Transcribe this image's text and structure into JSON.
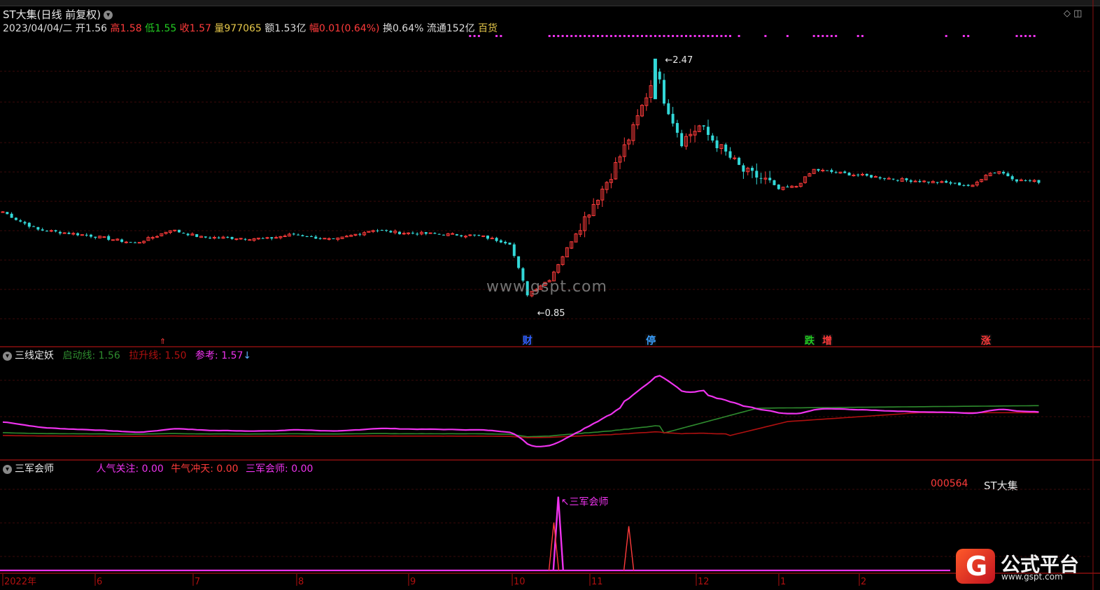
{
  "header": {
    "title": "ST大集(日线 前复权)",
    "info": {
      "date": "2023/04/04/二",
      "open_label": "开",
      "open": "1.56",
      "high_label": "高",
      "high": "1.58",
      "low_label": "低",
      "low": "1.55",
      "close_label": "收",
      "close": "1.57",
      "vol_label": "量",
      "vol": "977065",
      "amt_label": "额",
      "amt": "1.53亿",
      "chg_label": "幅",
      "chg": "0.01(0.64%)",
      "turn_label": "换",
      "turn": "0.64%",
      "float_label": "流通",
      "float": "152亿",
      "sector": "百货"
    }
  },
  "watermark": "www.gspt.com",
  "logo": {
    "title": "公式平台",
    "url": "www.gspt.com"
  },
  "colors": {
    "up": "#ff3b3b",
    "down": "#32d8d8",
    "magenta": "#ee33ee",
    "green": "#2e8b2e",
    "darkred": "#b01010",
    "axis": "#b01010"
  },
  "chart_data": [
    {
      "type": "candlestick",
      "title": "ST大集(日线 前复权)",
      "ylim": [
        0.7,
        2.6
      ],
      "annotations": [
        {
          "label": "2.47",
          "x_index": 148,
          "value": 2.47,
          "kind": "high"
        },
        {
          "label": "0.85",
          "x_index": 119,
          "value": 0.85,
          "kind": "low"
        }
      ],
      "signals": [
        {
          "label": "财",
          "x_index": 119,
          "color": "#3060ff"
        },
        {
          "label": "停",
          "x_index": 147,
          "color": "#3aa0ff"
        },
        {
          "label": "跌",
          "x_index": 183,
          "color": "#22cc22"
        },
        {
          "label": "增",
          "x_index": 187,
          "color": "#ff3b3b"
        },
        {
          "label": "涨",
          "x_index": 223,
          "color": "#ff3b3b"
        }
      ],
      "x_axis": {
        "labels": [
          "2022年",
          "6",
          "7",
          "8",
          "9",
          "10",
          "11",
          "12",
          "1",
          "2"
        ]
      }
    },
    {
      "type": "line",
      "title": "三线定妖",
      "legend": [
        {
          "name": "启动线",
          "value": "1.56",
          "color": "#2e8b2e"
        },
        {
          "name": "拉升线",
          "value": "1.50",
          "color": "#b01010"
        },
        {
          "name": "参考",
          "value": "1.57",
          "color": "#ee33ee"
        }
      ],
      "ylim": [
        0.8,
        2.6
      ]
    },
    {
      "type": "line",
      "title": "三军会师",
      "legend": [
        {
          "name": "人气关注",
          "value": "0.00",
          "color": "#ee33ee"
        },
        {
          "name": "牛气冲天",
          "value": "0.00",
          "color": "#ff3b3b"
        },
        {
          "name": "三军会师",
          "value": "0.00",
          "color": "#ee33ee"
        }
      ],
      "stock_code": "000564",
      "stock_name": "ST大集",
      "peak_label": "三军会师",
      "spikes": [
        {
          "x_index": 126,
          "value": 1.0,
          "color": "#ee33ee"
        },
        {
          "x_index": 125,
          "value": 0.65,
          "color": "#ff3b3b"
        },
        {
          "x_index": 142,
          "value": 0.6,
          "color": "#ff3b3b"
        }
      ],
      "ylim": [
        0,
        1.1
      ]
    }
  ]
}
